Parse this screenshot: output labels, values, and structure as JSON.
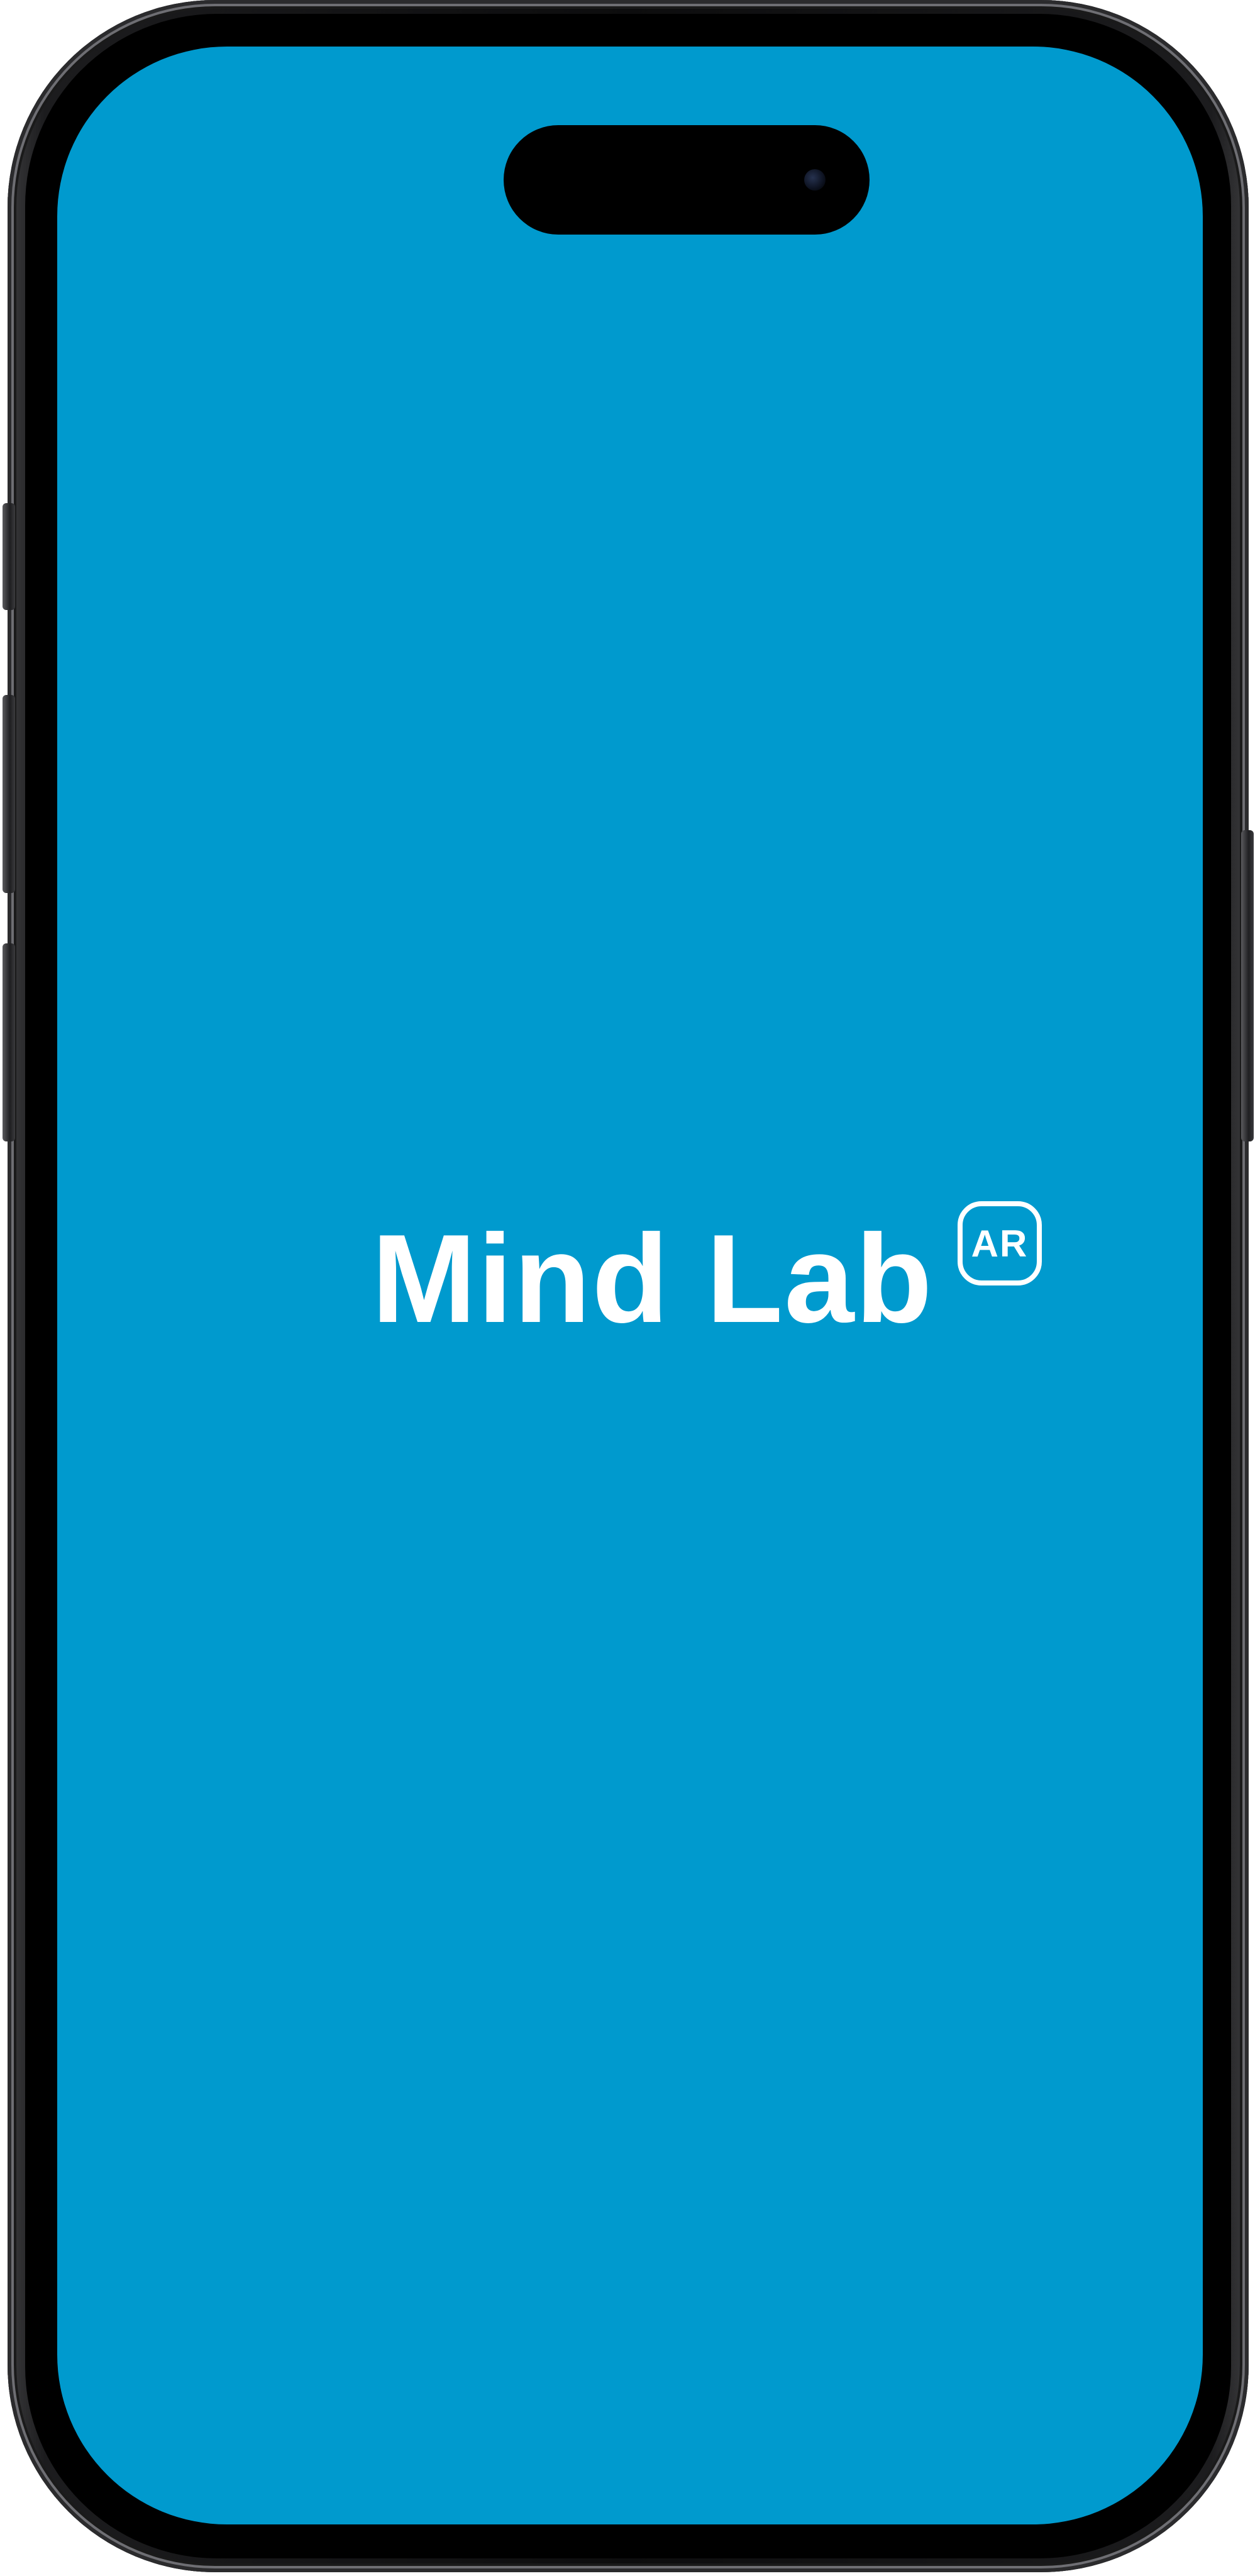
{
  "app": {
    "name": "Mind Lab",
    "badge": "AR"
  },
  "theme": {
    "background": "#009ACE",
    "foreground": "#FFFFFF",
    "device_frame": "#000000"
  },
  "device": {
    "island_icon": "camera-icon"
  }
}
